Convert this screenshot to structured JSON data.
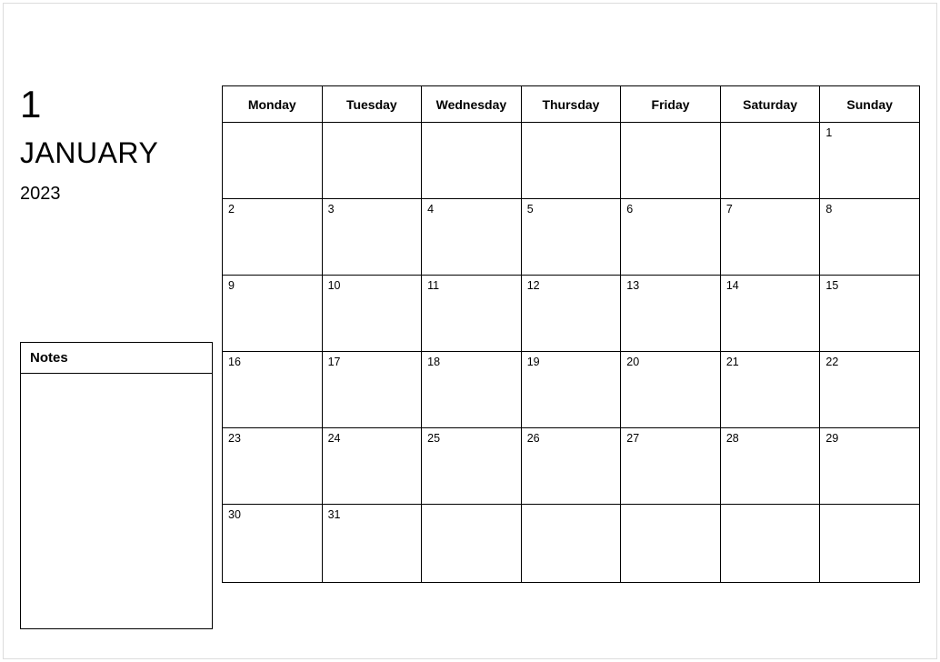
{
  "month_number": "1",
  "month_name": "JANUARY",
  "year": "2023",
  "notes_label": "Notes",
  "notes_content": "",
  "weekdays": [
    "Monday",
    "Tuesday",
    "Wednesday",
    "Thursday",
    "Friday",
    "Saturday",
    "Sunday"
  ],
  "weeks": [
    [
      "",
      "",
      "",
      "",
      "",
      "",
      "1"
    ],
    [
      "2",
      "3",
      "4",
      "5",
      "6",
      "7",
      "8"
    ],
    [
      "9",
      "10",
      "11",
      "12",
      "13",
      "14",
      "15"
    ],
    [
      "16",
      "17",
      "18",
      "19",
      "20",
      "21",
      "22"
    ],
    [
      "23",
      "24",
      "25",
      "26",
      "27",
      "28",
      "29"
    ],
    [
      "30",
      "31",
      "",
      "",
      "",
      "",
      ""
    ]
  ]
}
